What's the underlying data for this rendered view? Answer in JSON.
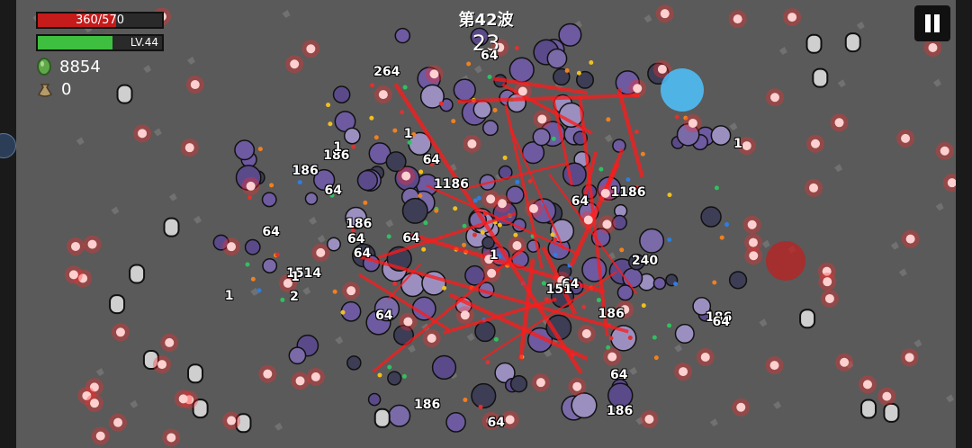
{
  "hud": {
    "hp_text": "360/570",
    "hp_fraction": 0.63,
    "xp_level": "LV.44",
    "xp_fraction": 0.6,
    "currency_amount": "8854",
    "bag_amount": "0",
    "wave_label": "第42波",
    "wave_timer": "23"
  },
  "colors": {
    "hp": "#c51b1b",
    "xp": "#3fbf3f",
    "laser": "#ff1a1a",
    "orb": "#ff2a2a",
    "arena": "#5a5a5a"
  },
  "icons": {
    "currency": "green-gem-icon",
    "bag": "money-bag-icon",
    "pause": "pause-icon"
  },
  "damage_numbers": [
    "64",
    "64",
    "1514",
    "186",
    "186",
    "186",
    "1186",
    "186",
    "64",
    "186",
    "1",
    "1",
    "186",
    "64",
    "2",
    "1",
    "186",
    "64",
    "64",
    "64",
    "64",
    "64",
    "64",
    "64",
    "1",
    "64",
    "151",
    "64",
    "240",
    "264",
    "1186",
    "1",
    "1"
  ]
}
